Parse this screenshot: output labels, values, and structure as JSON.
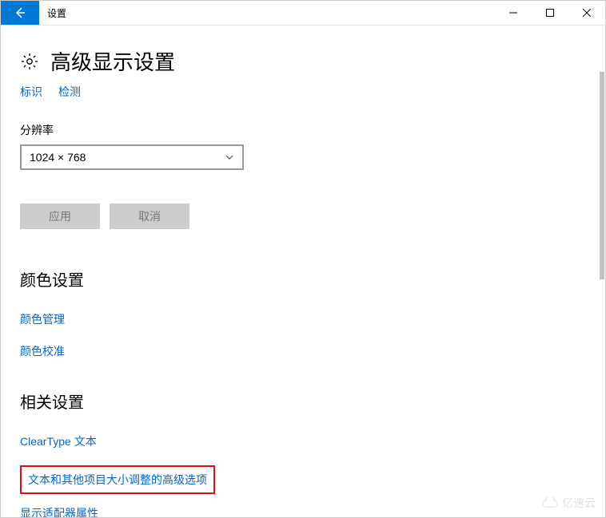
{
  "window": {
    "title": "设置"
  },
  "page": {
    "title": "高级显示设置",
    "identify_link": "标识",
    "detect_link": "检测"
  },
  "resolution": {
    "label": "分辨率",
    "value": "1024 × 768"
  },
  "buttons": {
    "apply": "应用",
    "cancel": "取消"
  },
  "color_section": {
    "title": "颜色设置",
    "links": {
      "color_management": "颜色管理",
      "color_calibration": "颜色校准"
    }
  },
  "related_section": {
    "title": "相关设置",
    "links": {
      "cleartype": "ClearType 文本",
      "advanced_sizing": "文本和其他项目大小调整的高级选项",
      "adapter_properties": "显示适配器属性"
    }
  },
  "watermark": "亿速云"
}
